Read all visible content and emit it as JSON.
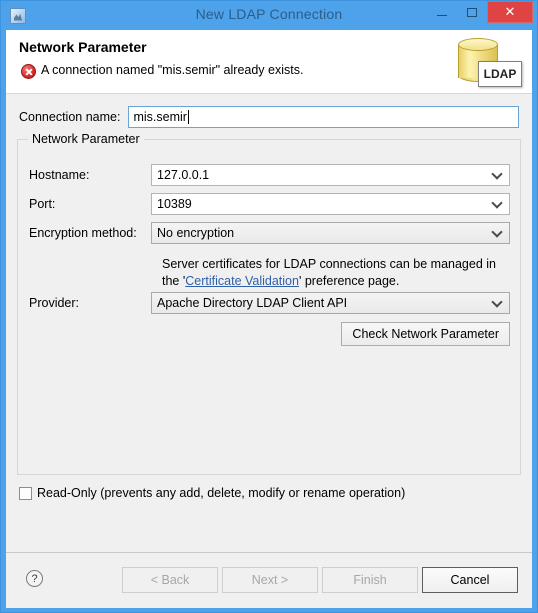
{
  "window": {
    "title": "New LDAP Connection",
    "icon": "app-icon",
    "caption": {
      "minimize": "minimize-icon",
      "maximize": "maximize-icon",
      "close": "✕"
    }
  },
  "header": {
    "title": "Network Parameter",
    "message": "A connection named \"mis.semir\" already exists.",
    "status_icon": "error-icon",
    "logo_label": "LDAP",
    "error_color": "#d52b2b"
  },
  "form": {
    "connection_name": {
      "label": "Connection name:",
      "value": "mis.semir"
    },
    "group_title": "Network Parameter",
    "fields": [
      {
        "label": "Hostname:",
        "value": "127.0.0.1",
        "readonly": false
      },
      {
        "label": "Port:",
        "value": "10389",
        "readonly": false
      },
      {
        "label": "Encryption method:",
        "value": "No encryption",
        "readonly": true
      }
    ],
    "cert_note": {
      "prefix": "Server certificates for LDAP connections can be managed in the '",
      "link": "Certificate Validation",
      "suffix": "' preference page."
    },
    "provider": {
      "label": "Provider:",
      "value": "Apache Directory LDAP Client API"
    },
    "check_button": "Check Network Parameter",
    "read_only": {
      "label": "Read-Only (prevents any add, delete, modify or rename operation)",
      "checked": false
    }
  },
  "footer": {
    "help": "?",
    "buttons": [
      {
        "label": "< Back",
        "enabled": false
      },
      {
        "label": "Next >",
        "enabled": false
      },
      {
        "label": "Finish",
        "enabled": false
      },
      {
        "label": "Cancel",
        "enabled": true
      }
    ]
  }
}
